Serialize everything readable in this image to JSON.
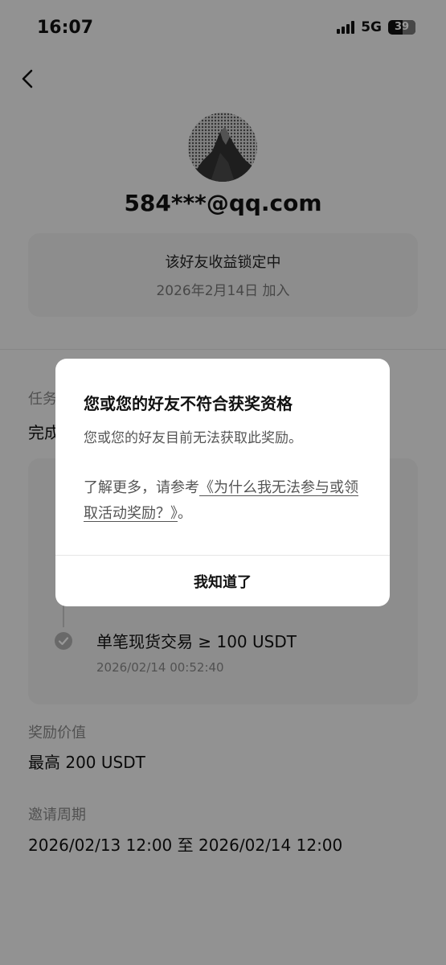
{
  "status_bar": {
    "time": "16:07",
    "network": "5G",
    "battery": "39"
  },
  "profile": {
    "email": "584***@qq.com"
  },
  "status_card": {
    "line1": "该好友收益锁定中",
    "line2": "2026年2月14日 加入"
  },
  "task": {
    "label_visible": "任务",
    "text_visible": "完成",
    "step_title": "单笔现货交易 ≥ 100 USDT",
    "step_time": "2026/02/14 00:52:40"
  },
  "reward": {
    "label": "奖励价值",
    "value": "最高 200 USDT"
  },
  "period": {
    "label": "邀请周期",
    "value": "2026/02/13 12:00 至 2026/02/14 12:00"
  },
  "dialog": {
    "title": "您或您的好友不符合获奖资格",
    "message": "您或您的好友目前无法获取此奖励。",
    "learn_more_prefix": "了解更多，请参考",
    "learn_more_link": "《为什么我无法参与或领取活动奖励？》",
    "learn_more_suffix": "。",
    "button": "我知道了"
  }
}
